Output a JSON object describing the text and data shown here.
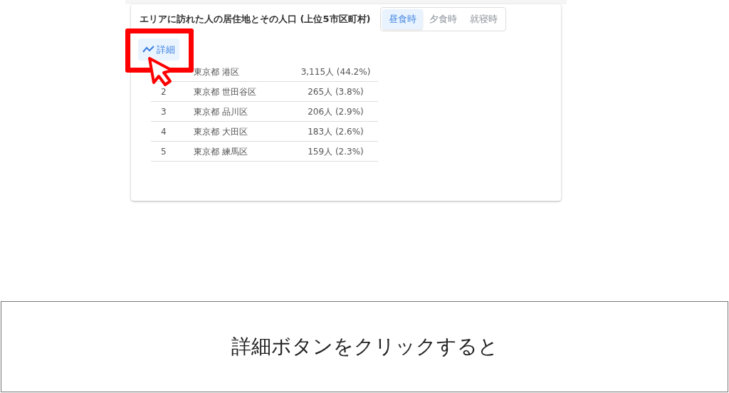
{
  "card": {
    "title": "エリアに訪れた人の居住地とその人口 (上位5市区町村)",
    "time_tabs": [
      {
        "label": "昼食時",
        "selected": true
      },
      {
        "label": "夕食時",
        "selected": false
      },
      {
        "label": "就寝時",
        "selected": false
      }
    ],
    "detail_button": {
      "label": "詳細"
    },
    "rows": [
      {
        "area": "東京都 港区",
        "count": "3,115人 (44.2%)"
      },
      {
        "rank": "2",
        "area": "東京都 世田谷区",
        "count": "265人 (3.8%)"
      },
      {
        "rank": "3",
        "area": "東京都 品川区",
        "count": "206人 (2.9%)"
      },
      {
        "rank": "4",
        "area": "東京都 大田区",
        "count": "183人 (2.6%)"
      },
      {
        "rank": "5",
        "area": "東京都 練馬区",
        "count": "159人 (2.3%)"
      }
    ]
  },
  "caption": "詳細ボタンをクリックすると"
}
